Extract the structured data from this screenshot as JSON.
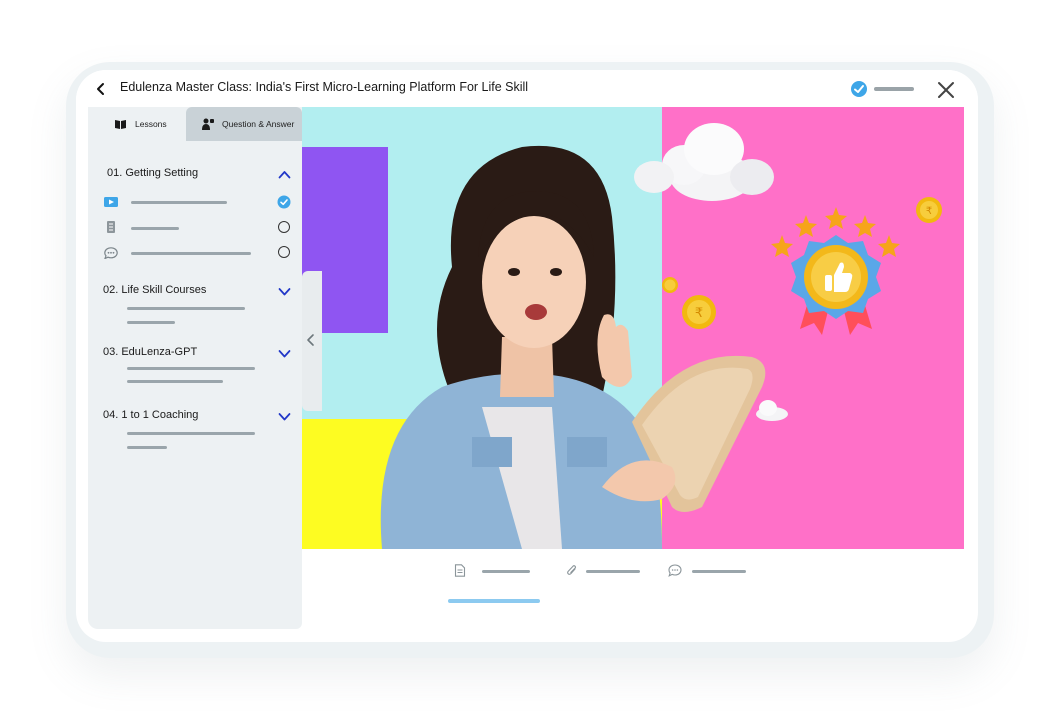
{
  "header": {
    "title": "Edulenza Master Class: India's First Micro-Learning Platform For Life Skill"
  },
  "sidebar": {
    "tabs": [
      {
        "label": "Lessons",
        "active": true,
        "icon": "book-icon"
      },
      {
        "label": "Question & Answer",
        "active": false,
        "icon": "person-question-icon"
      }
    ],
    "sections": [
      {
        "label": "01.  Getting Setting",
        "expanded": true
      },
      {
        "label": "02.  Life Skill Courses",
        "expanded": false
      },
      {
        "label": "03. EduLenza-GPT",
        "expanded": false
      },
      {
        "label": "04. 1 to 1 Coaching",
        "expanded": false
      }
    ],
    "lesson_items": [
      {
        "icon": "video-icon",
        "status": "completed"
      },
      {
        "icon": "document-icon",
        "status": "pending"
      },
      {
        "icon": "chat-icon",
        "status": "pending"
      }
    ]
  },
  "bottom_tabs": [
    {
      "icon": "document-icon",
      "active": true
    },
    {
      "icon": "attachment-icon",
      "active": false
    },
    {
      "icon": "chat-icon",
      "active": false
    }
  ],
  "colors": {
    "accent_blue": "#3ea6e8",
    "cyan": "#b2eef0",
    "pink": "#ff70c8",
    "purple": "#8f55f2",
    "yellow": "#fdfc22",
    "nav_blue": "#2238c8"
  }
}
